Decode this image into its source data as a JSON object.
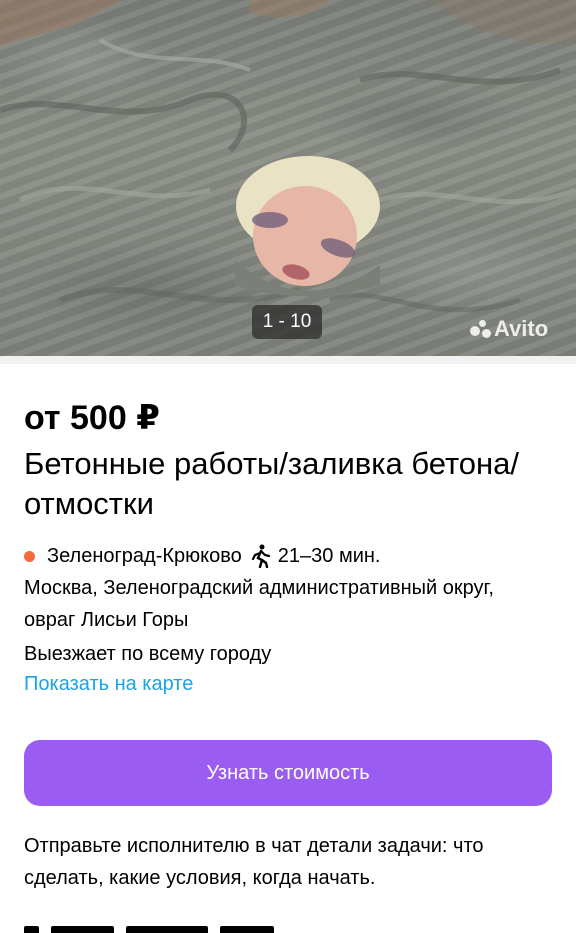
{
  "photo": {
    "counter": "1 - 10",
    "watermark": "Avito",
    "description_icon": "concrete-photo"
  },
  "listing": {
    "price": "от 500 ₽",
    "title": "Бетонные работы/заливка бетона/отмостки"
  },
  "location": {
    "metro": "Зеленоград-Крюково",
    "walk_time": "21–30 мин.",
    "address": "Москва, Зеленоградский административный округ, овраг Лисьи Горы",
    "visits": "Выезжает по всему городу",
    "map_link": "Показать на карте"
  },
  "actions": {
    "price_button": "Узнать стоимость"
  },
  "hint": {
    "text": "Отправьте исполнителю в чат детали задачи: что сделать, какие условия, когда начать."
  },
  "colors": {
    "accent": "#9b5cf2",
    "link": "#1ca3e3",
    "metro_dot": "#f36b3d"
  }
}
